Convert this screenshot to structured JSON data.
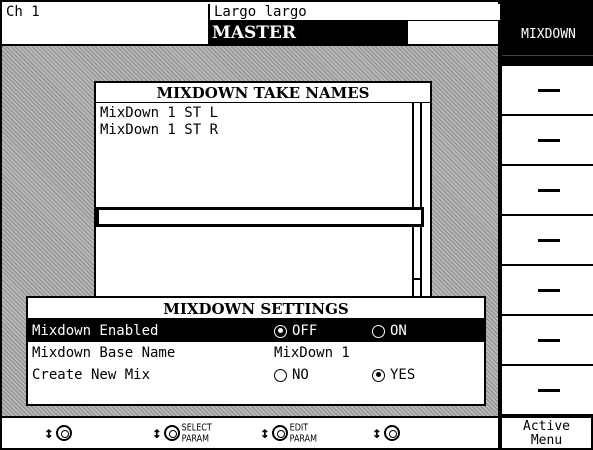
{
  "header": {
    "channel": "Ch 1",
    "project_name": "Largo largo",
    "screen_title": "MASTER"
  },
  "take_names": {
    "title": "MIXDOWN TAKE NAMES",
    "items": [
      "MixDown 1 ST L",
      "MixDown 1 ST R"
    ],
    "input_value": ""
  },
  "settings": {
    "title": "MIXDOWN SETTINGS",
    "rows": [
      {
        "label": "Mixdown Enabled",
        "options": [
          {
            "label": "OFF",
            "selected": true
          },
          {
            "label": "ON",
            "selected": false
          }
        ],
        "highlighted": true
      },
      {
        "label": "Mixdown Base Name",
        "value": "MixDown 1"
      },
      {
        "label": "Create New Mix",
        "options": [
          {
            "label": "NO",
            "selected": false
          },
          {
            "label": "YES",
            "selected": true
          }
        ]
      }
    ]
  },
  "menu": {
    "title": "MIXDOWN",
    "slots": [
      "—",
      "—",
      "—",
      "—",
      "—",
      "—",
      "—"
    ],
    "active_menu": "Active Menu"
  },
  "knobs": [
    {
      "top": "",
      "bottom": ""
    },
    {
      "top": "SELECT",
      "bottom": "PARAM"
    },
    {
      "top": "EDIT",
      "bottom": "PARAM"
    },
    {
      "top": "",
      "bottom": ""
    }
  ]
}
